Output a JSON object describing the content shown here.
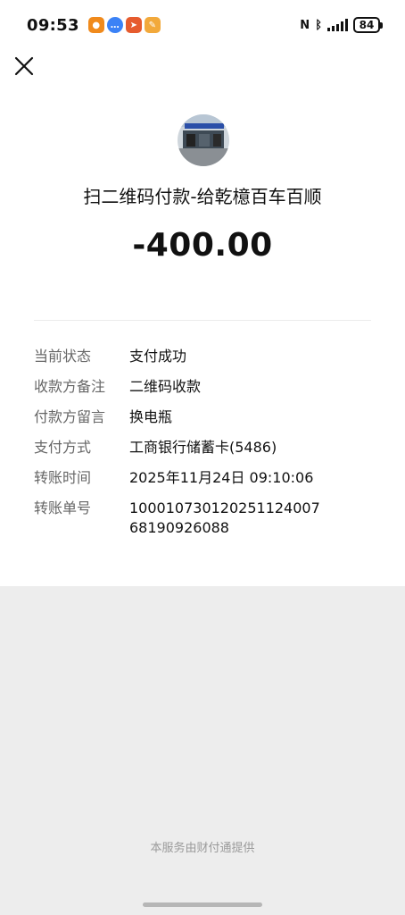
{
  "status_bar": {
    "time": "09:53",
    "battery": "84",
    "notification_icons": [
      {
        "name": "app-icon-orange",
        "color": "#f08a1c"
      },
      {
        "name": "message-icon-blue",
        "color": "#3b82f6"
      },
      {
        "name": "app-icon-orange-red",
        "color": "#e65b2e"
      },
      {
        "name": "app-icon-yellow",
        "color": "#f2a93b"
      }
    ]
  },
  "top_bar": {
    "close_icon": "close-icon"
  },
  "payment": {
    "title": "扫二维码付款-给乾檍百车百顺",
    "amount": "-400.00"
  },
  "details": [
    {
      "label": "当前状态",
      "value": "支付成功"
    },
    {
      "label": "收款方备注",
      "value": "二维码收款"
    },
    {
      "label": "付款方留言",
      "value": "换电瓶"
    },
    {
      "label": "支付方式",
      "value": "工商银行储蓄卡(5486)"
    },
    {
      "label": "转账时间",
      "value": "2025年11月24日 09:10:06"
    },
    {
      "label": "转账单号",
      "value": "10001073012025112400768190926088"
    }
  ],
  "footer": {
    "text": "本服务由财付通提供"
  }
}
